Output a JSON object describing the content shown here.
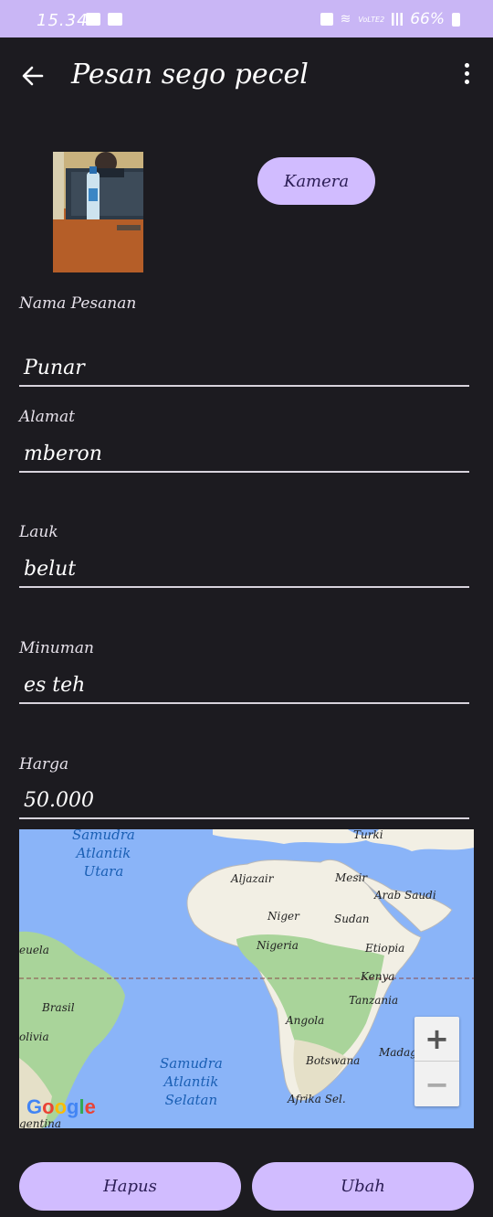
{
  "status_bar": {
    "time": "15.34",
    "network": "VoLTE2",
    "battery": "66%"
  },
  "app_bar": {
    "title": "Pesan sego pecel",
    "back_icon": "arrow-left-icon",
    "menu_icon": "more-vert-icon"
  },
  "camera_button": "Kamera",
  "form": {
    "nama_label": "Nama Pesanan",
    "nama_value": "Punar",
    "alamat_label": "Alamat",
    "alamat_value": "mberon",
    "lauk_label": "Lauk",
    "lauk_value": "belut",
    "minuman_label": "Minuman",
    "minuman_value": "es teh",
    "harga_label": "Harga",
    "harga_value": "50.000"
  },
  "map": {
    "labels": {
      "turki": "Turki",
      "aljazair": "Aljazair",
      "mesir": "Mesir",
      "arab_saudi": "Arab Saudi",
      "niger": "Niger",
      "sudan": "Sudan",
      "nigeria": "Nigeria",
      "etiopia": "Etiopia",
      "venezuela": "euela",
      "kenya": "Kenya",
      "brasil": "Brasil",
      "tanzania": "Tanzania",
      "angola": "Angola",
      "bolivia": "olivia",
      "madagaskar": "Madagaskar",
      "botswana": "Botswana",
      "afrika_sel": "Afrika Sel.",
      "argentina": "gentina"
    },
    "ocean_north": "Samudra\nAtlantik\nUtara",
    "ocean_south": "Samudra\nAtlantik\nSelatan",
    "zoom_in": "+",
    "zoom_out": "−",
    "attribution": "Google"
  },
  "actions": {
    "hapus": "Hapus",
    "ubah": "Ubah"
  },
  "colors": {
    "background": "#1c1b20",
    "accent": "#d1bcff",
    "status_bar": "#c9b6f5",
    "ocean": "#8ab4f8"
  }
}
